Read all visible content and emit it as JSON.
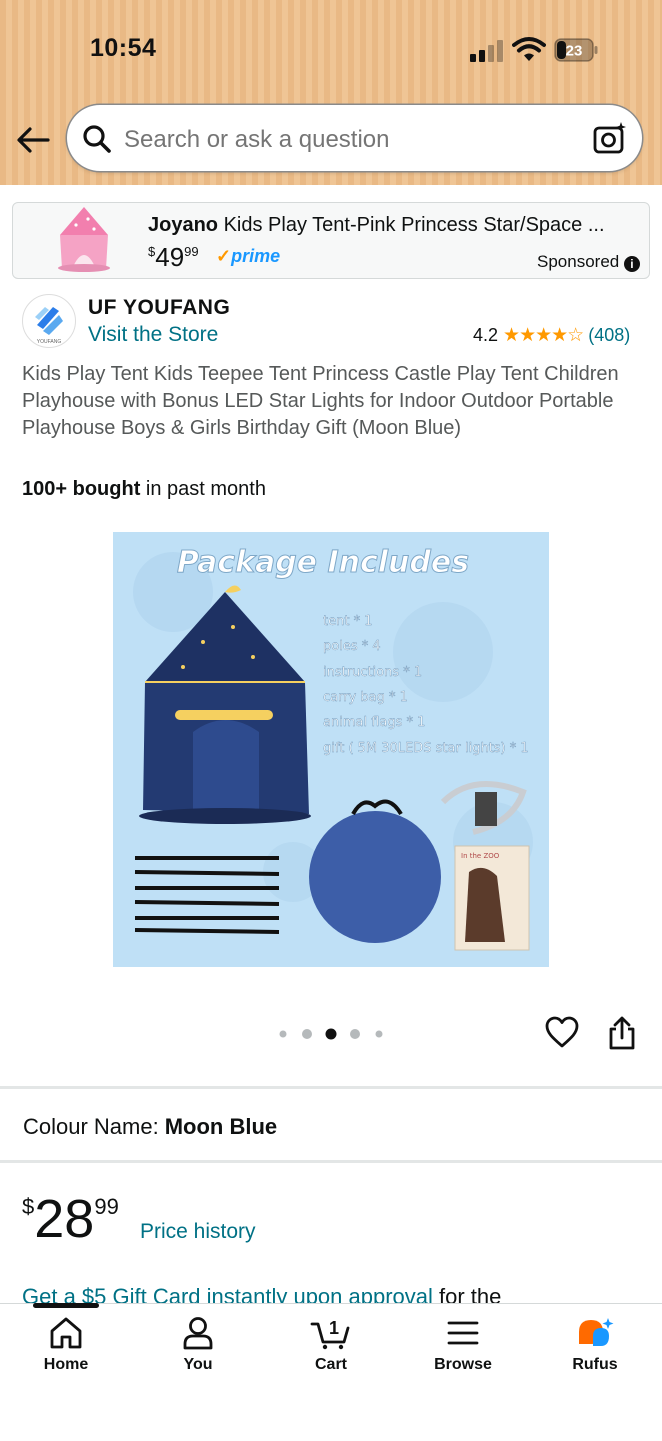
{
  "status_bar": {
    "time": "10:54",
    "battery": "23"
  },
  "search": {
    "placeholder": "Search or ask a question"
  },
  "sponsored_ad": {
    "brand": "Joyano",
    "title": "Kids Play Tent-Pink Princess Star/Space ...",
    "price_currency": "$",
    "price_whole": "49",
    "price_cents": "99",
    "prime_label": "prime",
    "sponsored_label": "Sponsored"
  },
  "store": {
    "name": "UF YOUFANG",
    "logo_text": "YOUFANG",
    "visit_label": "Visit the Store",
    "rating_value": "4.2",
    "stars_filled": 4.2,
    "rating_count": "(408)"
  },
  "product": {
    "title": "Kids Play Tent Kids Teepee Tent Princess Castle Play Tent Children Playhouse with Bonus LED Star Lights for Indoor Outdoor Portable Playhouse Boys & Girls Birthday Gift (Moon Blue)",
    "bought_bold": "100+ bought",
    "bought_rest": " in past month"
  },
  "image": {
    "heading": "Package Includes",
    "items": [
      "tent * 1",
      "poles * 4",
      "instructions * 1",
      "carry bag * 1",
      "animal flags * 1",
      "gift ( 5M 30LEDS star lights) * 1"
    ],
    "card_text": "In the ZOO"
  },
  "carousel": {
    "count": 5,
    "active_index": 2
  },
  "colour": {
    "label": "Colour Name:",
    "value": "Moon Blue"
  },
  "price": {
    "currency": "$",
    "whole": "28",
    "cents": "99",
    "history_label": "Price history"
  },
  "promo": {
    "link_text": "Get a $5 Gift Card instantly upon approval",
    "rest": " for the"
  },
  "nav": {
    "items": [
      {
        "label": "Home",
        "icon": "home-icon"
      },
      {
        "label": "You",
        "icon": "person-icon"
      },
      {
        "label": "Cart",
        "icon": "cart-icon",
        "badge": "1"
      },
      {
        "label": "Browse",
        "icon": "menu-icon"
      },
      {
        "label": "Rufus",
        "icon": "rufus-icon"
      }
    ]
  },
  "colors": {
    "link": "#007185",
    "star": "#ff9900",
    "prime": "#1a98ff",
    "header": "#e9b985",
    "rufus": "#ff6a00"
  }
}
